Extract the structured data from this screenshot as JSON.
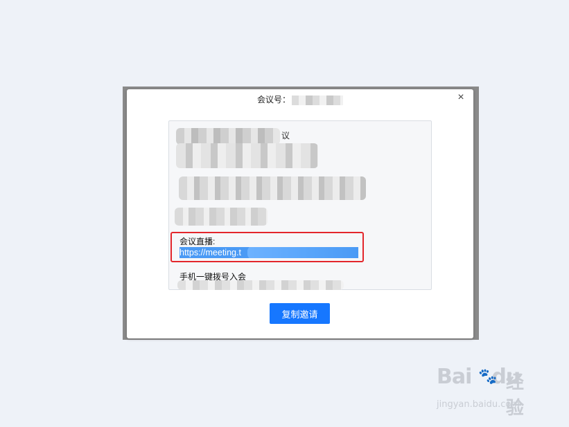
{
  "dialog": {
    "title_label": "会议号：",
    "close_glyph": "×"
  },
  "invite": {
    "fragment_1": "议",
    "live_label": "会议直播:",
    "live_url": "https://meeting.t",
    "phone_label": "手机一键拨号入会"
  },
  "actions": {
    "copy_label": "复制邀请"
  },
  "watermark": {
    "brand": "Bai",
    "paw": "🐾",
    "brand2": "du",
    "cn": "经验",
    "domain": "jingyan.baidu.com"
  },
  "colors": {
    "accent": "#1677ff",
    "highlight_border": "#e3262b",
    "selection": "#4a9af5"
  }
}
